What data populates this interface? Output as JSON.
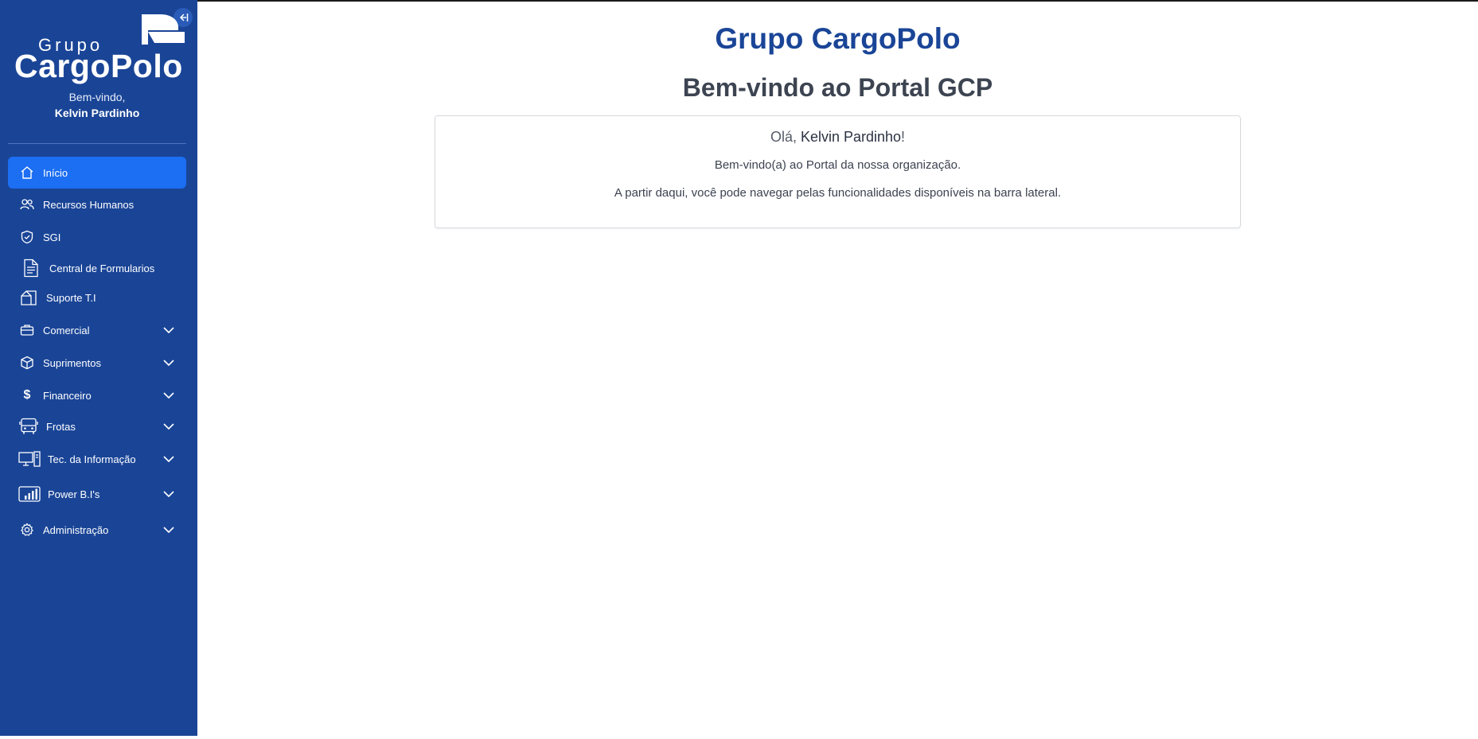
{
  "brand": {
    "logo_small": "Grupo",
    "logo_big": "CargoPolo"
  },
  "sidebar": {
    "welcome_line": "Bem-vindo,",
    "user_name": "Kelvin Pardinho",
    "items": [
      {
        "label": "Início",
        "icon": "home-icon",
        "active": true
      },
      {
        "label": "Recursos Humanos",
        "icon": "users-icon"
      },
      {
        "label": "SGI",
        "icon": "shield-icon"
      },
      {
        "label": "Central de Formularios",
        "icon": "document-icon"
      },
      {
        "label": "Suporte T.I",
        "icon": "building-icon"
      },
      {
        "label": "Comercial",
        "icon": "briefcase-icon",
        "expandable": true
      },
      {
        "label": "Suprimentos",
        "icon": "box-icon",
        "expandable": true
      },
      {
        "label": "Financeiro",
        "icon": "dollar-icon",
        "expandable": true
      },
      {
        "label": "Frotas",
        "icon": "bus-icon",
        "expandable": true
      },
      {
        "label": "Tec. da Informação",
        "icon": "computer-icon",
        "expandable": true
      },
      {
        "label": "Power B.I's",
        "icon": "chart-icon",
        "expandable": true
      },
      {
        "label": "Administração",
        "icon": "gear-icon",
        "expandable": true
      }
    ]
  },
  "main": {
    "title": "Grupo CargoPolo",
    "subtitle": "Bem-vindo ao Portal GCP",
    "card": {
      "greeting_prefix": "Olá, ",
      "greeting_name": "Kelvin Pardinho",
      "greeting_suffix": "!",
      "line1": "Bem-vindo(a) ao Portal da nossa organização.",
      "line2": "A partir daqui, você pode navegar pelas funcionalidades disponíveis na barra lateral."
    }
  },
  "colors": {
    "sidebar_bg": "#1a4597",
    "active_item": "#1c6ef2",
    "title_blue": "#1a4597"
  }
}
